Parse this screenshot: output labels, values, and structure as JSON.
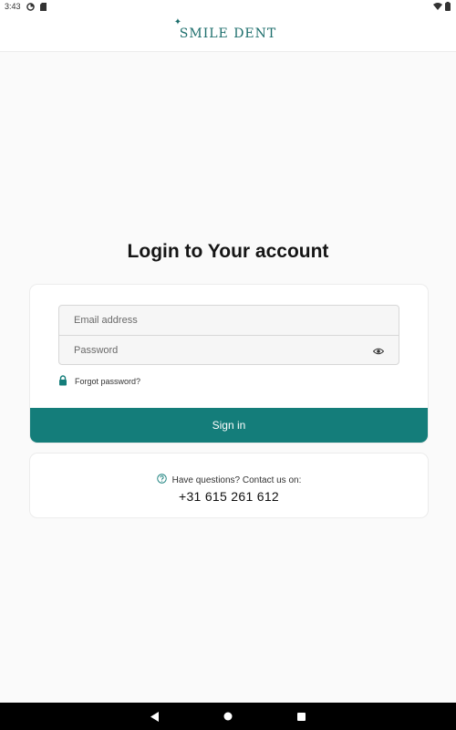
{
  "status_bar": {
    "time": "3:43",
    "icons": [
      "data-saver-icon",
      "sim-card-icon",
      "wifi-icon",
      "battery-icon"
    ]
  },
  "header": {
    "logo_text": "SMILE DENT"
  },
  "login": {
    "title": "Login to Your account",
    "email_placeholder": "Email address",
    "password_placeholder": "Password",
    "forgot_label": "Forgot password?",
    "signin_label": "Sign in"
  },
  "contact": {
    "question": "Have questions? Contact us on:",
    "phone": "+31 615 261 612"
  },
  "colors": {
    "accent": "#147d7a",
    "logo": "#1d6e6c",
    "background": "#fafafa"
  }
}
